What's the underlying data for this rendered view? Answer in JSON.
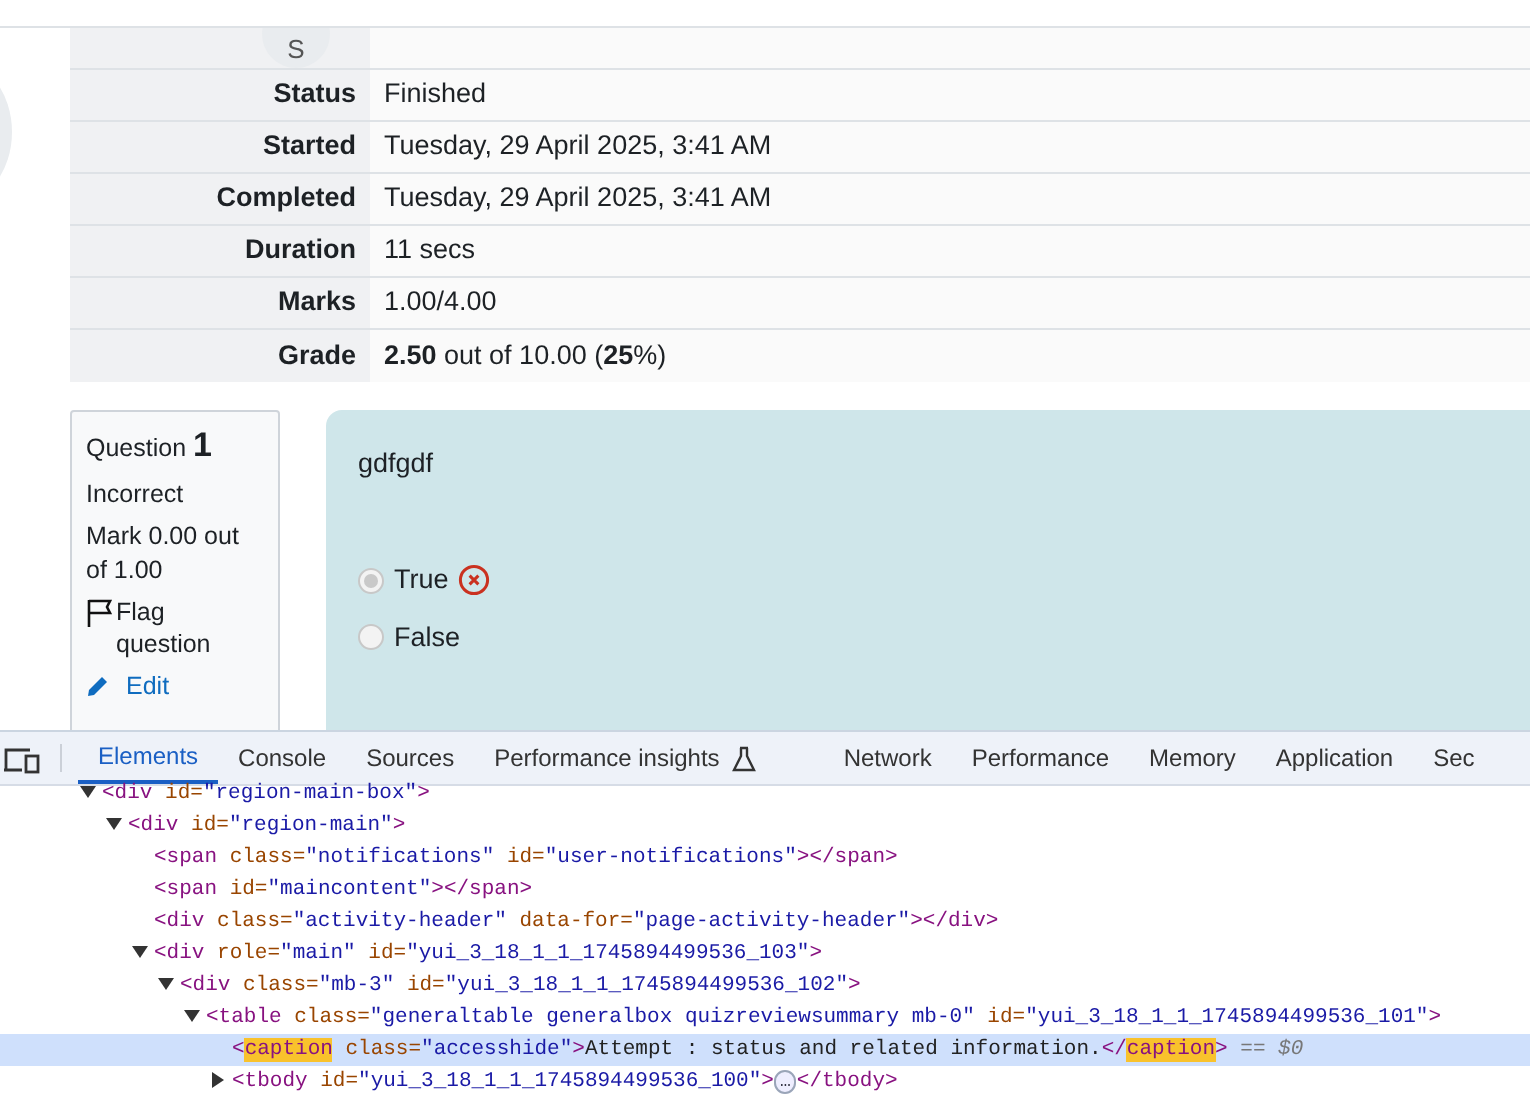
{
  "summary": {
    "avatar_initial": "S",
    "rows": [
      {
        "label": "Status",
        "value": "Finished"
      },
      {
        "label": "Started",
        "value": "Tuesday, 29 April 2025, 3:41 AM"
      },
      {
        "label": "Completed",
        "value": "Tuesday, 29 April 2025, 3:41 AM"
      },
      {
        "label": "Duration",
        "value": "11 secs"
      },
      {
        "label": "Marks",
        "value": "1.00/4.00"
      },
      {
        "label": "Grade",
        "value": "**2.50** out of 10.00 (**25**%)"
      }
    ]
  },
  "question": {
    "label": "Question",
    "number": "1",
    "state": "Incorrect",
    "mark": "Mark 0.00 out of 1.00",
    "flag": "Flag question",
    "edit": "Edit",
    "text": "gdfgdf",
    "options": [
      {
        "label": "True",
        "selected": true,
        "incorrect": true
      },
      {
        "label": "False",
        "selected": false,
        "incorrect": false
      }
    ]
  },
  "devtools": {
    "tabs": [
      {
        "label": "Elements",
        "selected": true,
        "kind": "plain"
      },
      {
        "label": "Console",
        "selected": false,
        "kind": "plain"
      },
      {
        "label": "Sources",
        "selected": false,
        "kind": "plain"
      },
      {
        "label": "Performance insights",
        "selected": false,
        "kind": "experimental"
      },
      {
        "label": "Network",
        "selected": false,
        "kind": "plain"
      },
      {
        "label": "Performance",
        "selected": false,
        "kind": "plain"
      },
      {
        "label": "Memory",
        "selected": false,
        "kind": "plain"
      },
      {
        "label": "Application",
        "selected": false,
        "kind": "plain"
      },
      {
        "label": "Sec",
        "selected": false,
        "kind": "plain"
      }
    ],
    "tree": [
      {
        "expanded": true,
        "selected": false,
        "tokens": [
          {
            "kind": "tag",
            "t": "<div"
          },
          {
            "kind": "attr",
            "t": " id="
          },
          {
            "kind": "val",
            "t": "\"region-main-box\""
          },
          {
            "kind": "tag",
            "t": ">"
          }
        ],
        "children": [
          {
            "expanded": true,
            "selected": false,
            "tokens": [
              {
                "kind": "tag",
                "t": "<div"
              },
              {
                "kind": "attr",
                "t": " id="
              },
              {
                "kind": "val",
                "t": "\"region-main\""
              },
              {
                "kind": "tag",
                "t": ">"
              }
            ],
            "children": [
              {
                "selected": false,
                "tokens": [
                  {
                    "kind": "tag",
                    "t": "<span"
                  },
                  {
                    "kind": "attr",
                    "t": " class="
                  },
                  {
                    "kind": "val",
                    "t": "\"notifications\""
                  },
                  {
                    "kind": "attr",
                    "t": " id="
                  },
                  {
                    "kind": "val",
                    "t": "\"user-notifications\""
                  },
                  {
                    "kind": "tag",
                    "t": "></span>"
                  }
                ]
              },
              {
                "selected": false,
                "tokens": [
                  {
                    "kind": "tag",
                    "t": "<span"
                  },
                  {
                    "kind": "attr",
                    "t": " id="
                  },
                  {
                    "kind": "val",
                    "t": "\"maincontent\""
                  },
                  {
                    "kind": "tag",
                    "t": "></span>"
                  }
                ]
              },
              {
                "selected": false,
                "tokens": [
                  {
                    "kind": "tag",
                    "t": "<div"
                  },
                  {
                    "kind": "attr",
                    "t": " class="
                  },
                  {
                    "kind": "val",
                    "t": "\"activity-header\""
                  },
                  {
                    "kind": "attr",
                    "t": " data-for="
                  },
                  {
                    "kind": "val",
                    "t": "\"page-activity-header\""
                  },
                  {
                    "kind": "tag",
                    "t": "></div>"
                  }
                ]
              },
              {
                "expanded": true,
                "selected": false,
                "tokens": [
                  {
                    "kind": "tag",
                    "t": "<div"
                  },
                  {
                    "kind": "attr",
                    "t": " role="
                  },
                  {
                    "kind": "val",
                    "t": "\"main\""
                  },
                  {
                    "kind": "attr",
                    "t": " id="
                  },
                  {
                    "kind": "val",
                    "t": "\"yui_3_18_1_1_1745894499536_103\""
                  },
                  {
                    "kind": "tag",
                    "t": ">"
                  }
                ],
                "children": [
                  {
                    "expanded": true,
                    "selected": false,
                    "tokens": [
                      {
                        "kind": "tag",
                        "t": "<div"
                      },
                      {
                        "kind": "attr",
                        "t": " class="
                      },
                      {
                        "kind": "val",
                        "t": "\"mb-3\""
                      },
                      {
                        "kind": "attr",
                        "t": " id="
                      },
                      {
                        "kind": "val",
                        "t": "\"yui_3_18_1_1_1745894499536_102\""
                      },
                      {
                        "kind": "tag",
                        "t": ">"
                      }
                    ],
                    "children": [
                      {
                        "expanded": true,
                        "selected": false,
                        "tokens": [
                          {
                            "kind": "tag",
                            "t": "<table"
                          },
                          {
                            "kind": "attr",
                            "t": " class="
                          },
                          {
                            "kind": "val",
                            "t": "\"generaltable generalbox quizreviewsummary mb-0\""
                          },
                          {
                            "kind": "attr",
                            "t": " id="
                          },
                          {
                            "kind": "val",
                            "t": "\"yui_3_18_1_1_1745894499536_101\""
                          },
                          {
                            "kind": "tag",
                            "t": ">"
                          }
                        ],
                        "children": [
                          {
                            "selected": true,
                            "tokens": [
                              {
                                "kind": "tag",
                                "t": "<"
                              },
                              {
                                "kind": "match",
                                "t": "caption"
                              },
                              {
                                "kind": "attr",
                                "t": " class="
                              },
                              {
                                "kind": "val",
                                "t": "\"accesshide\""
                              },
                              {
                                "kind": "tag",
                                "t": ">"
                              },
                              {
                                "kind": "text",
                                "t": "Attempt : status and related information."
                              },
                              {
                                "kind": "tag",
                                "t": "</"
                              },
                              {
                                "kind": "match",
                                "t": "caption"
                              },
                              {
                                "kind": "tag",
                                "t": ">"
                              },
                              {
                                "kind": "hint",
                                "t": " == $0"
                              }
                            ]
                          },
                          {
                            "expanded": false,
                            "selected": false,
                            "tokens": [
                              {
                                "kind": "tag",
                                "t": "<tbody"
                              },
                              {
                                "kind": "attr",
                                "t": " id="
                              },
                              {
                                "kind": "val",
                                "t": "\"yui_3_18_1_1_1745894499536_100\""
                              },
                              {
                                "kind": "tag",
                                "t": ">"
                              },
                              {
                                "kind": "more",
                                "t": "…"
                              },
                              {
                                "kind": "tag",
                                "t": "</tbody>"
                              }
                            ]
                          }
                        ]
                      }
                    ]
                  }
                ]
              }
            ]
          }
        ]
      }
    ]
  }
}
